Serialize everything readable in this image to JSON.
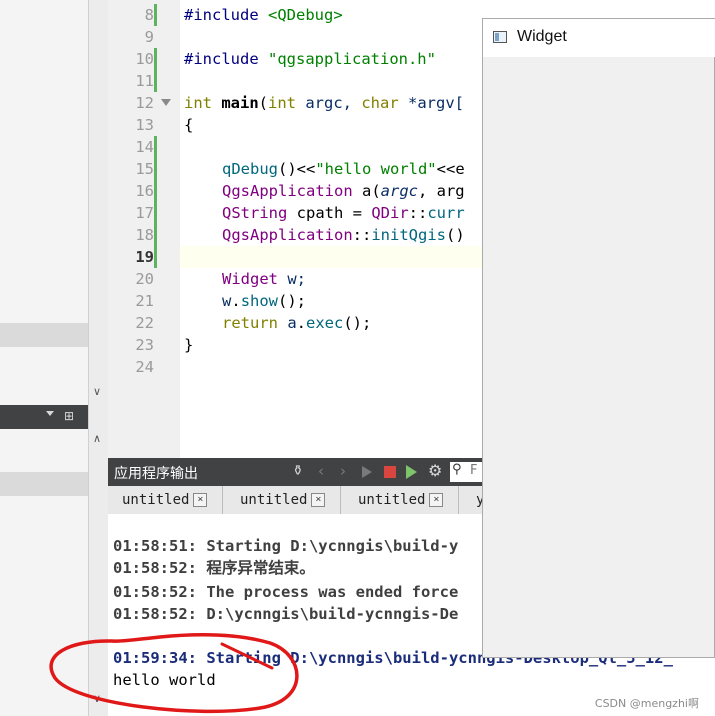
{
  "editor": {
    "line_numbers": [
      "8",
      "9",
      "10",
      "11",
      "12",
      "13",
      "14",
      "15",
      "16",
      "17",
      "18",
      "19",
      "20",
      "21",
      "22",
      "23",
      "24"
    ],
    "current_line": "19",
    "lines": {
      "l8": {
        "a": "#include ",
        "b": "<QDebug>"
      },
      "l10": {
        "a": "#include ",
        "b": "\"qgsapplication.h\""
      },
      "l12": {
        "a": "int",
        "b": " main",
        "c": "(",
        "d": "int",
        "e": " argc, ",
        "f": "char",
        "g": " *argv["
      },
      "l13": {
        "a": "{"
      },
      "l15": {
        "a": "qDebug",
        "b": "()<<",
        "c": "\"hello world\"",
        "d": "<<e"
      },
      "l16": {
        "a": "QgsApplication",
        "b": " a(",
        "c": "argc",
        "d": ", arg"
      },
      "l17": {
        "a": "QString",
        "b": " cpath = ",
        "c": "QDir",
        "d": "::",
        "e": "curr"
      },
      "l18": {
        "a": "QgsApplication",
        "b": "::",
        "c": "initQgis",
        "d": "()"
      },
      "l20": {
        "a": "Widget",
        "b": " w;"
      },
      "l21": {
        "a": "w",
        "b": ".",
        "c": "show",
        "d": "();"
      },
      "l22": {
        "a": "return",
        "b": " a",
        "c": ".",
        "d": "exec",
        "e": "();"
      },
      "l23": {
        "a": "}"
      }
    }
  },
  "output_pane": {
    "title": "应用程序输出",
    "filter_placeholder": "F",
    "tabs": [
      "untitled",
      "untitled",
      "untitled",
      "y"
    ],
    "lines": [
      "01:58:51: Starting D:\\ycnngis\\build-y",
      "01:58:52: 程序异常结束。",
      "01:58:52: The process was ended force",
      "01:58:52: D:\\ycnngis\\build-ycnngis-De",
      "01:59:34: Starting D:\\ycnngis\\build-ycnngis-Desktop_Qt_5_12_",
      "hello world"
    ]
  },
  "widget_window": {
    "title": "Widget"
  },
  "watermark": "CSDN @mengzhi啊",
  "colors": {
    "annotation_red": "#e01818",
    "toolbar_dark": "#404244"
  }
}
